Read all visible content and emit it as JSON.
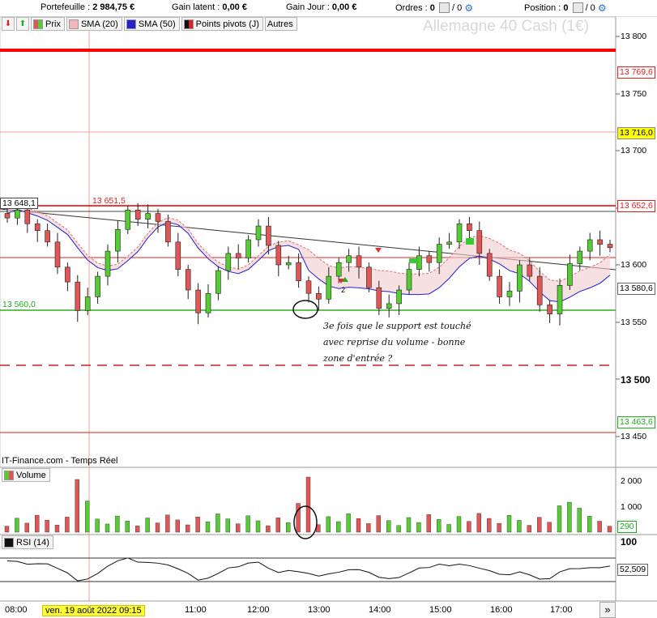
{
  "toolbar": {
    "portefeuille_label": "Portefeuille :",
    "portefeuille_value": "2 984,75 €",
    "gain_latent_label": "Gain latent :",
    "gain_latent_value": "0,00 €",
    "gain_jour_label": "Gain Jour :",
    "gain_jour_value": "0,00 €",
    "ordres_label": "Ordres :",
    "ordres_value": "0",
    "ordres_total": "/ 0",
    "position_label": "Position :",
    "position_value": "0",
    "position_total": "/ 0"
  },
  "legend": {
    "prix": "Prix",
    "sma20": "SMA (20)",
    "sma50": "SMA (50)",
    "pivots": "Points pivots (J)",
    "autres": "Autres"
  },
  "instrument": "Allemagne 40 Cash (1€)",
  "price_axis": [
    "13 800",
    "13 750",
    "13 700",
    "13 650",
    "13 600",
    "13 550",
    "13 500",
    "13 450"
  ],
  "price_tags": {
    "r1": "13 769,6",
    "pivot_yellow": "13 716,0",
    "red_level": "13 652,6",
    "last": "13 580,6",
    "s1": "13 463,6",
    "left_high": "13 648,1",
    "high_mark": "13 651,5",
    "support": "13 560,0"
  },
  "annotation": {
    "line1": "3e fois que le support est touché",
    "line2": "avec reprise du volume - bonne",
    "line3": "zone d'entrée ?"
  },
  "signal_count": "2",
  "source_label": "IT-Finance.com - Temps Réel",
  "volume_panel": {
    "title": "Volume",
    "axis": [
      "2 000",
      "1 000"
    ],
    "last": "290"
  },
  "rsi_panel": {
    "title": "RSI (14)",
    "axis_top": "100",
    "last": "52,509"
  },
  "time_axis": [
    "08:00",
    "11:00",
    "12:00",
    "13:00",
    "14:00",
    "15:00",
    "16:00",
    "17:00"
  ],
  "date_tag": "ven. 19 août 2022 09:15",
  "scroll_label": "»",
  "colors": {
    "up": "#55cc33",
    "down": "#e05555",
    "sma20": "#e8b0b0",
    "sma50": "#2222cc",
    "support": "#33aa22",
    "resistance": "#ff0000",
    "pivot": "#ffff00"
  },
  "chart_data": {
    "type": "candlestick",
    "interval_minutes": 5,
    "ohlc_close": [
      13641,
      13648,
      13636,
      13630,
      13620,
      13598,
      13585,
      13560,
      13572,
      13590,
      13612,
      13631,
      13648,
      13640,
      13645,
      13638,
      13620,
      13596,
      13578,
      13558,
      13575,
      13595,
      13610,
      13606,
      13622,
      13634,
      13617,
      13600,
      13602,
      13586,
      13575,
      13570,
      13590,
      13602,
      13608,
      13598,
      13580,
      13562,
      13566,
      13578,
      13596,
      13608,
      13602,
      13618,
      13620,
      13636,
      13630,
      13610,
      13590,
      13572,
      13577,
      13600,
      13590,
      13565,
      13557,
      13582,
      13601,
      13612,
      13622,
      13618,
      13615
    ],
    "volume_max": 2300,
    "rsi_last": 52.509
  }
}
